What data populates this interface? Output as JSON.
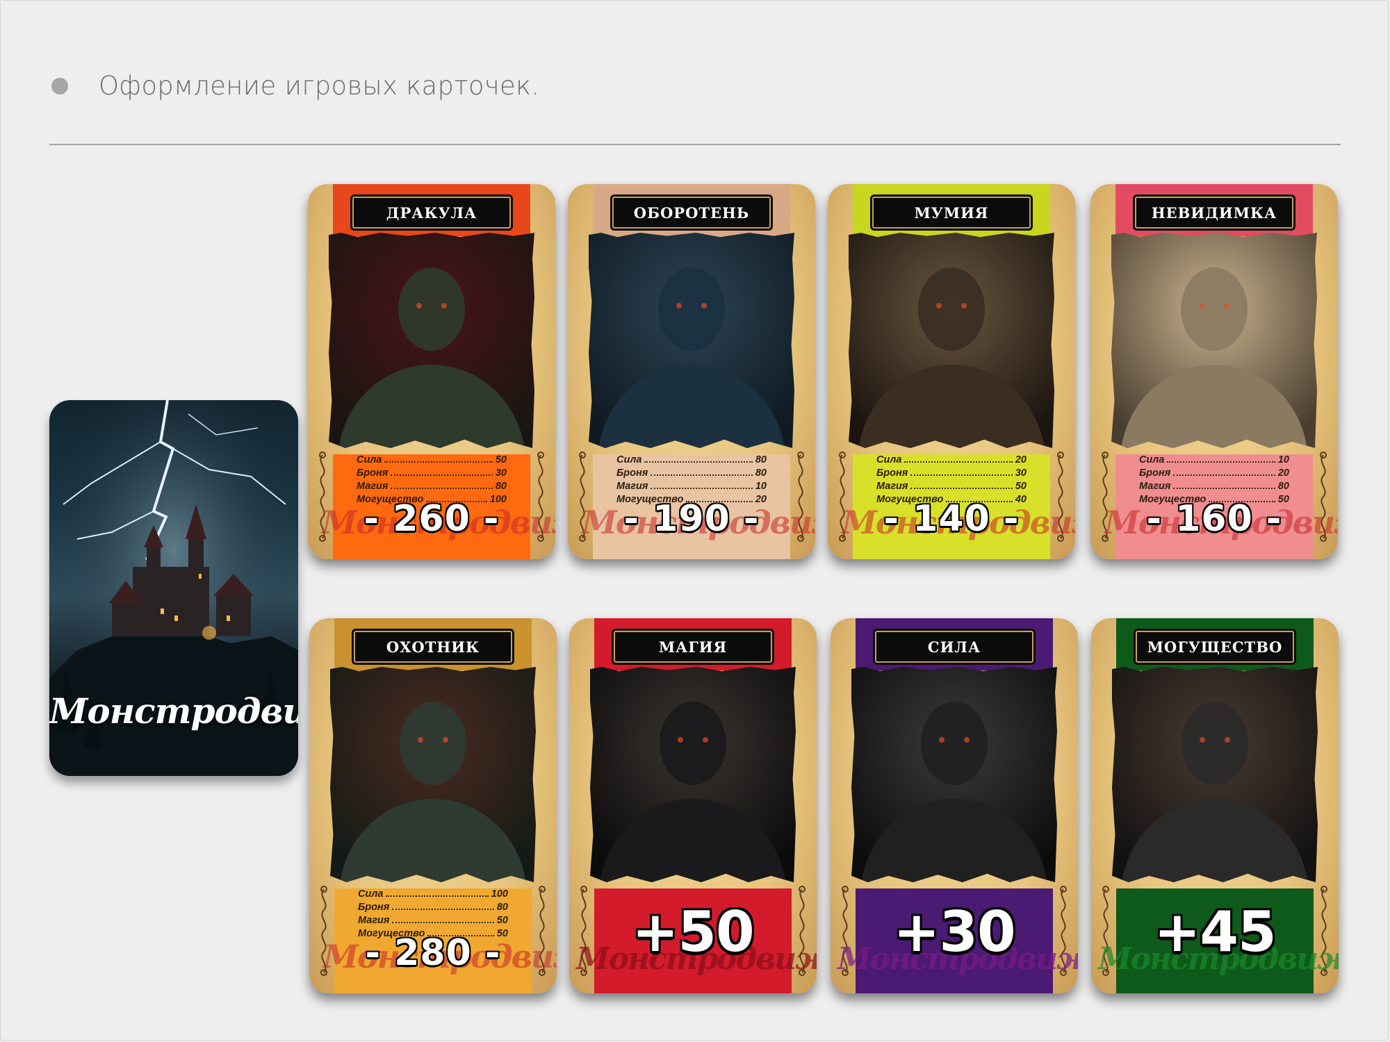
{
  "heading": "Оформление игровых карточек.",
  "cover": {
    "title": "Монстродвиж"
  },
  "stat_labels": [
    "Сила",
    "Броня",
    "Магия",
    "Могущество"
  ],
  "monster_cards": [
    {
      "name": "ДРАКУЛА",
      "stats": [
        50,
        30,
        80,
        100
      ],
      "total": "- 260 -",
      "color": "#ff6a10",
      "band": "#e8471b"
    },
    {
      "name": "ОБОРОТЕНЬ",
      "stats": [
        80,
        80,
        10,
        20
      ],
      "total": "- 190 -",
      "color": "#e8c4a2",
      "band": "#d9a987"
    },
    {
      "name": "МУМИЯ",
      "stats": [
        20,
        30,
        50,
        40
      ],
      "total": "- 140 -",
      "color": "#d8e02a",
      "band": "#c8d61e"
    },
    {
      "name": "НЕВИДИМКА",
      "stats": [
        10,
        20,
        80,
        50
      ],
      "total": "- 160 -",
      "color": "#f08d8f",
      "band": "#e34c60"
    },
    {
      "name": "ОХОТНИК",
      "stats": [
        100,
        80,
        50,
        50
      ],
      "total": "- 280 -",
      "color": "#f0a830",
      "band": "#c9922e"
    }
  ],
  "bonus_cards": [
    {
      "name": "МАГИЯ",
      "value": "+50",
      "color": "#d31b2c"
    },
    {
      "name": "СИЛА",
      "value": "+30",
      "color": "#4b1a72"
    },
    {
      "name": "МОГУЩЕСТВО",
      "value": "+45",
      "color": "#0e5a1a"
    }
  ],
  "watermark": "Монстродвиж"
}
